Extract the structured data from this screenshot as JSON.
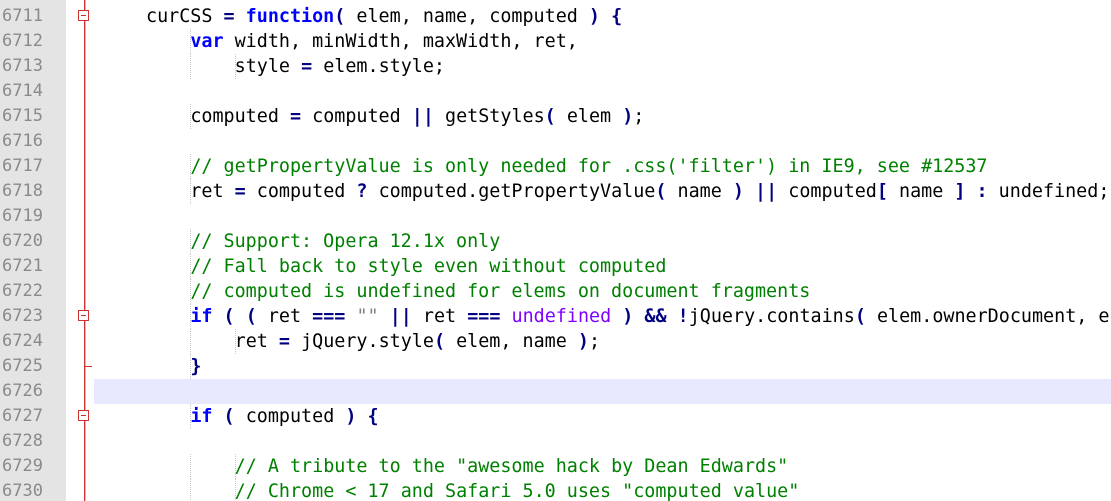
{
  "editor": {
    "colors": {
      "gutter_bg": "#e4e4e4",
      "fold_marker": "#cc3333",
      "current_line_bg": "#e8e8ff",
      "keyword": "#0000ff",
      "comment": "#008000",
      "undefined_literal": "#8000ff",
      "string": "#808080"
    },
    "current_line": "6726",
    "lines": [
      {
        "num": "6711",
        "indent": 1,
        "fold": "open",
        "tokens": [
          [
            "t",
            "curCSS "
          ],
          [
            "op",
            "="
          ],
          [
            "t",
            " "
          ],
          [
            "kw",
            "function"
          ],
          [
            "op",
            "("
          ],
          [
            "t",
            " elem, name, computed "
          ],
          [
            "op",
            ")"
          ],
          [
            "t",
            " "
          ],
          [
            "op",
            "{"
          ]
        ]
      },
      {
        "num": "6712",
        "indent": 2,
        "fold": "",
        "tokens": [
          [
            "kw",
            "var"
          ],
          [
            "t",
            " width, minWidth, maxWidth, ret,"
          ]
        ]
      },
      {
        "num": "6713",
        "indent": 3,
        "fold": "",
        "tokens": [
          [
            "t",
            "style "
          ],
          [
            "op",
            "="
          ],
          [
            "t",
            " elem.style;"
          ]
        ]
      },
      {
        "num": "6714",
        "indent": 0,
        "fold": "",
        "tokens": []
      },
      {
        "num": "6715",
        "indent": 2,
        "fold": "",
        "tokens": [
          [
            "t",
            "computed "
          ],
          [
            "op",
            "="
          ],
          [
            "t",
            " computed "
          ],
          [
            "op",
            "||"
          ],
          [
            "t",
            " getStyles"
          ],
          [
            "op",
            "("
          ],
          [
            "t",
            " elem "
          ],
          [
            "op",
            ")"
          ],
          [
            "t",
            ";"
          ]
        ]
      },
      {
        "num": "6716",
        "indent": 0,
        "fold": "",
        "tokens": []
      },
      {
        "num": "6717",
        "indent": 2,
        "fold": "",
        "tokens": [
          [
            "cm",
            "// getPropertyValue is only needed for .css('filter') in IE9, see #12537"
          ]
        ]
      },
      {
        "num": "6718",
        "indent": 2,
        "fold": "",
        "tokens": [
          [
            "t",
            "ret "
          ],
          [
            "op",
            "="
          ],
          [
            "t",
            " computed "
          ],
          [
            "op",
            "?"
          ],
          [
            "t",
            " computed.getPropertyValue"
          ],
          [
            "op",
            "("
          ],
          [
            "t",
            " name "
          ],
          [
            "op",
            ")"
          ],
          [
            "t",
            " "
          ],
          [
            "op",
            "||"
          ],
          [
            "t",
            " computed"
          ],
          [
            "op",
            "["
          ],
          [
            "t",
            " name "
          ],
          [
            "op",
            "]"
          ],
          [
            "t",
            " "
          ],
          [
            "op",
            ":"
          ],
          [
            "t",
            " undefined;"
          ]
        ]
      },
      {
        "num": "6719",
        "indent": 0,
        "fold": "",
        "tokens": []
      },
      {
        "num": "6720",
        "indent": 2,
        "fold": "",
        "tokens": [
          [
            "cm",
            "// Support: Opera 12.1x only"
          ]
        ]
      },
      {
        "num": "6721",
        "indent": 2,
        "fold": "",
        "tokens": [
          [
            "cm",
            "// Fall back to style even without computed"
          ]
        ]
      },
      {
        "num": "6722",
        "indent": 2,
        "fold": "",
        "tokens": [
          [
            "cm",
            "// computed is undefined for elems on document fragments"
          ]
        ]
      },
      {
        "num": "6723",
        "indent": 2,
        "fold": "open",
        "tokens": [
          [
            "kw",
            "if"
          ],
          [
            "t",
            " "
          ],
          [
            "op",
            "("
          ],
          [
            "t",
            " "
          ],
          [
            "op",
            "("
          ],
          [
            "t",
            " ret "
          ],
          [
            "op",
            "==="
          ],
          [
            "t",
            " "
          ],
          [
            "str",
            "\"\""
          ],
          [
            "t",
            " "
          ],
          [
            "op",
            "||"
          ],
          [
            "t",
            " ret "
          ],
          [
            "op",
            "==="
          ],
          [
            "t",
            " "
          ],
          [
            "und",
            "undefined"
          ],
          [
            "t",
            " "
          ],
          [
            "op",
            ")"
          ],
          [
            "t",
            " "
          ],
          [
            "op",
            "&&"
          ],
          [
            "t",
            " "
          ],
          [
            "op",
            "!"
          ],
          [
            "t",
            "jQuery.contains"
          ],
          [
            "op",
            "("
          ],
          [
            "t",
            " elem.ownerDocument, elem "
          ],
          [
            "op",
            "))"
          ],
          [
            "t",
            " "
          ],
          [
            "op",
            "{"
          ]
        ]
      },
      {
        "num": "6724",
        "indent": 3,
        "fold": "",
        "tokens": [
          [
            "t",
            "ret "
          ],
          [
            "op",
            "="
          ],
          [
            "t",
            " jQuery.style"
          ],
          [
            "op",
            "("
          ],
          [
            "t",
            " elem, name "
          ],
          [
            "op",
            ")"
          ],
          [
            "t",
            ";"
          ]
        ]
      },
      {
        "num": "6725",
        "indent": 2,
        "fold": "end",
        "tokens": [
          [
            "op",
            "}"
          ]
        ]
      },
      {
        "num": "6726",
        "indent": 0,
        "fold": "",
        "tokens": []
      },
      {
        "num": "6727",
        "indent": 2,
        "fold": "open",
        "tokens": [
          [
            "kw",
            "if"
          ],
          [
            "t",
            " "
          ],
          [
            "op",
            "("
          ],
          [
            "t",
            " computed "
          ],
          [
            "op",
            ")"
          ],
          [
            "t",
            " "
          ],
          [
            "op",
            "{"
          ]
        ]
      },
      {
        "num": "6728",
        "indent": 0,
        "fold": "",
        "tokens": []
      },
      {
        "num": "6729",
        "indent": 3,
        "fold": "",
        "tokens": [
          [
            "cm",
            "// A tribute to the \"awesome hack by Dean Edwards\""
          ]
        ]
      },
      {
        "num": "6730",
        "indent": 3,
        "fold": "",
        "tokens": [
          [
            "cm",
            "// Chrome < 17 and Safari 5.0 uses \"computed value\""
          ]
        ]
      }
    ]
  }
}
